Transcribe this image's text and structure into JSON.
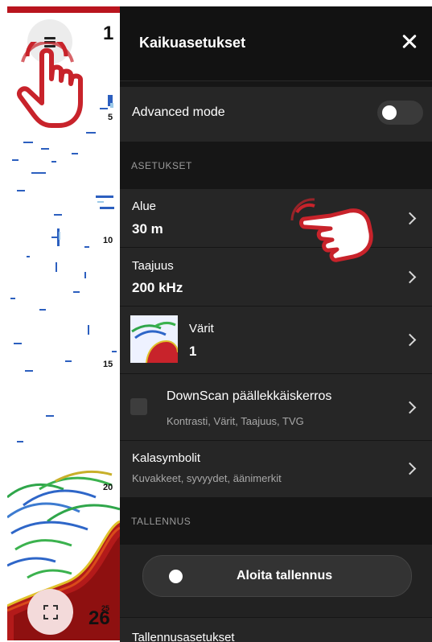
{
  "sonar": {
    "depth_top": "1",
    "depth_marks": [
      "5",
      "10",
      "15",
      "20"
    ],
    "bottom_depth": "26",
    "bottom_depth_small": "25"
  },
  "panel": {
    "title": "Kaikuasetukset",
    "advanced_mode_label": "Advanced mode",
    "advanced_mode_on": false,
    "settings_section": "ASETUKSET",
    "range_label": "Alue",
    "range_value": "30 m",
    "frequency_label": "Taajuus",
    "frequency_value": "200 kHz",
    "colors_label": "Värit",
    "colors_value": "1",
    "downscan_label": "DownScan päällekkäiskerros",
    "downscan_sub": "Kontrasti, Värit, Taajuus, TVG",
    "fish_label": "Kalasymbolit",
    "fish_sub": "Kuvakkeet, syvyydet, äänimerkit",
    "recording_section": "TALLENNUS",
    "record_button": "Aloita tallennus",
    "recording_settings_label": "Tallennusasetukset"
  },
  "colors": {
    "accent_red": "#c8232b",
    "panel_bg": "#161616",
    "row_bg": "#262626"
  },
  "icons": {
    "menu": "hamburger-icon",
    "close": "close-icon",
    "expand": "expand-icon",
    "tap_hint": "tap-hand-icon"
  }
}
